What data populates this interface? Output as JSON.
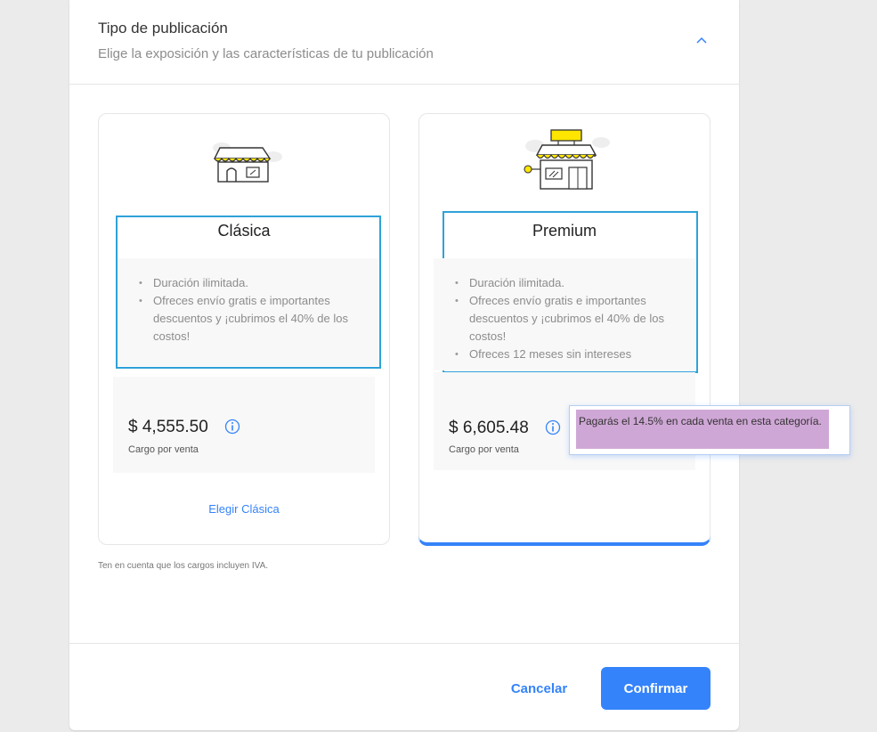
{
  "header": {
    "title": "Tipo de publicación",
    "subtitle": "Elige la exposición y las características de tu publicación",
    "collapse_icon": "chevron-up-icon"
  },
  "cards": {
    "clasica": {
      "name": "Clásica",
      "icon": "store-icon",
      "features": [
        "Duración ilimitada.",
        "Ofreces envío gratis e importantes descuentos y ¡cubrimos el 40% de los costos!"
      ],
      "price": "$ 4,555.50",
      "price_label": "Cargo por venta",
      "choose_label": "Elegir Clásica"
    },
    "premium": {
      "name": "Premium",
      "icon": "premium-store-icon",
      "features": [
        "Duración ilimitada.",
        "Ofreces envío gratis e importantes descuentos y ¡cubrimos el 40% de los costos!",
        "Ofreces 12 meses sin intereses"
      ],
      "price": "$ 6,605.48",
      "price_label": "Cargo por venta",
      "selected": true
    }
  },
  "tooltip": {
    "text": "Pagarás el 14.5% en cada venta en esta categoría."
  },
  "note": "Ten en cuenta que los cargos incluyen IVA.",
  "footer": {
    "cancel_label": "Cancelar",
    "confirm_label": "Confirmar"
  },
  "colors": {
    "accent": "#3483fa",
    "highlight_box": "#2fa2d8",
    "awning_yellow": "#ffe600",
    "tooltip_fill": "#cfa7d6"
  }
}
